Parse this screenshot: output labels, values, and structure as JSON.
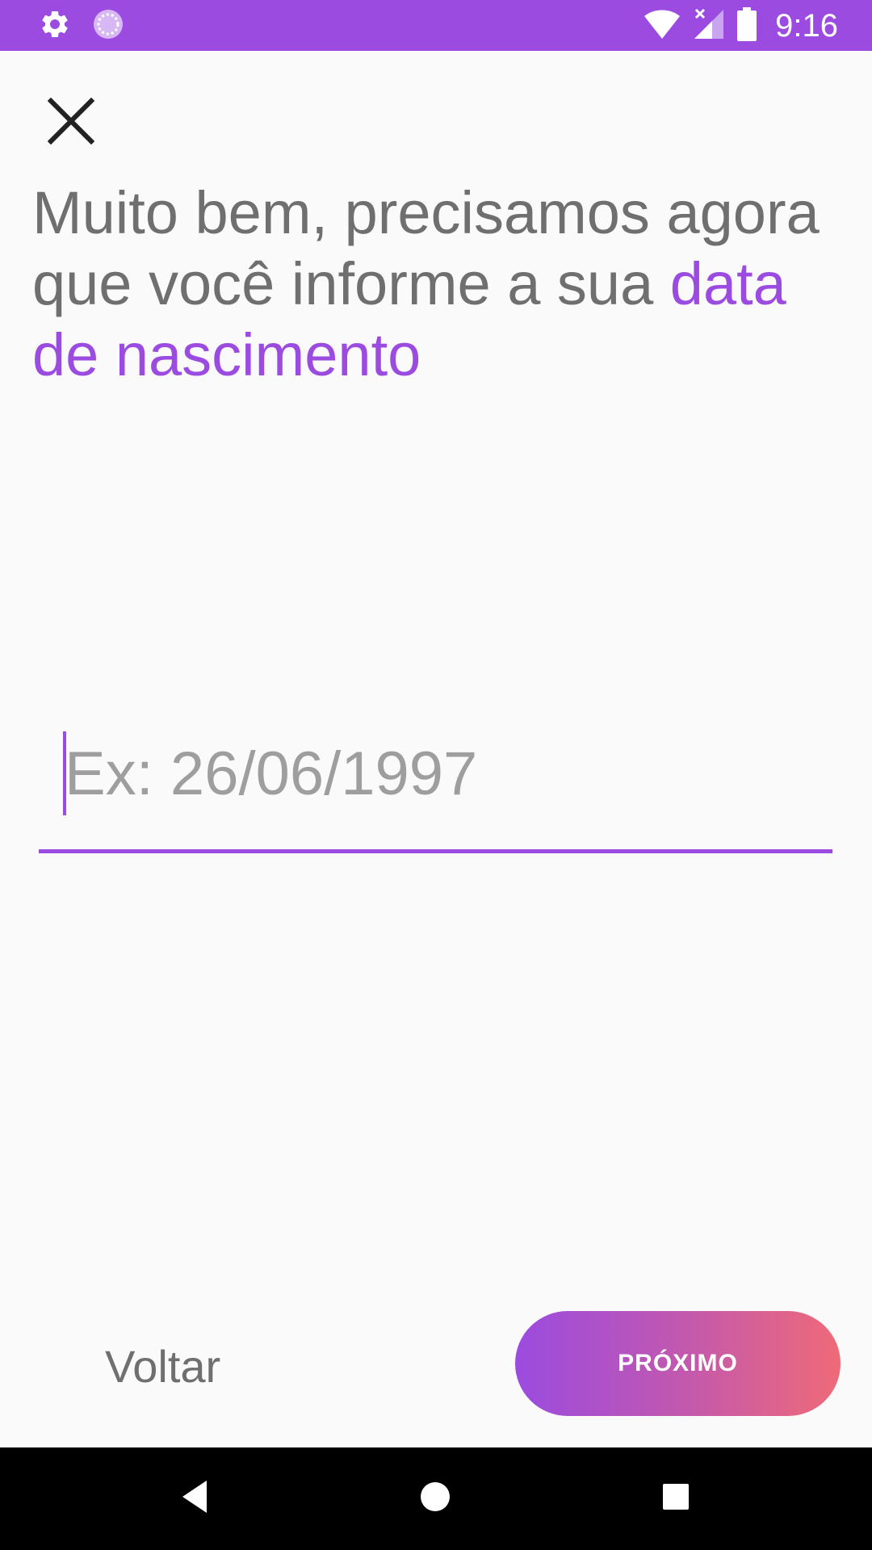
{
  "status_bar": {
    "time": "9:16",
    "icons": [
      "settings-icon",
      "sync-icon",
      "wifi-icon",
      "signal-icon",
      "battery-icon"
    ],
    "background_color": "#9b4be0"
  },
  "close_icon": "close-icon",
  "heading": {
    "text": " Muito bem, precisamos agora que você informe a sua ",
    "highlight": "data de nascimento",
    "text_color": "#6f6f6f",
    "highlight_color": "#9b4be0"
  },
  "birth_date_input": {
    "value": "",
    "placeholder": "Ex: 26/06/1997"
  },
  "footer": {
    "back_label": "Voltar",
    "next_label": "PRÓXIMO",
    "next_gradient": [
      "#9b4be0",
      "#ef6a78"
    ]
  },
  "nav_bar": {
    "icons": [
      "back-icon",
      "home-icon",
      "recents-icon"
    ]
  }
}
